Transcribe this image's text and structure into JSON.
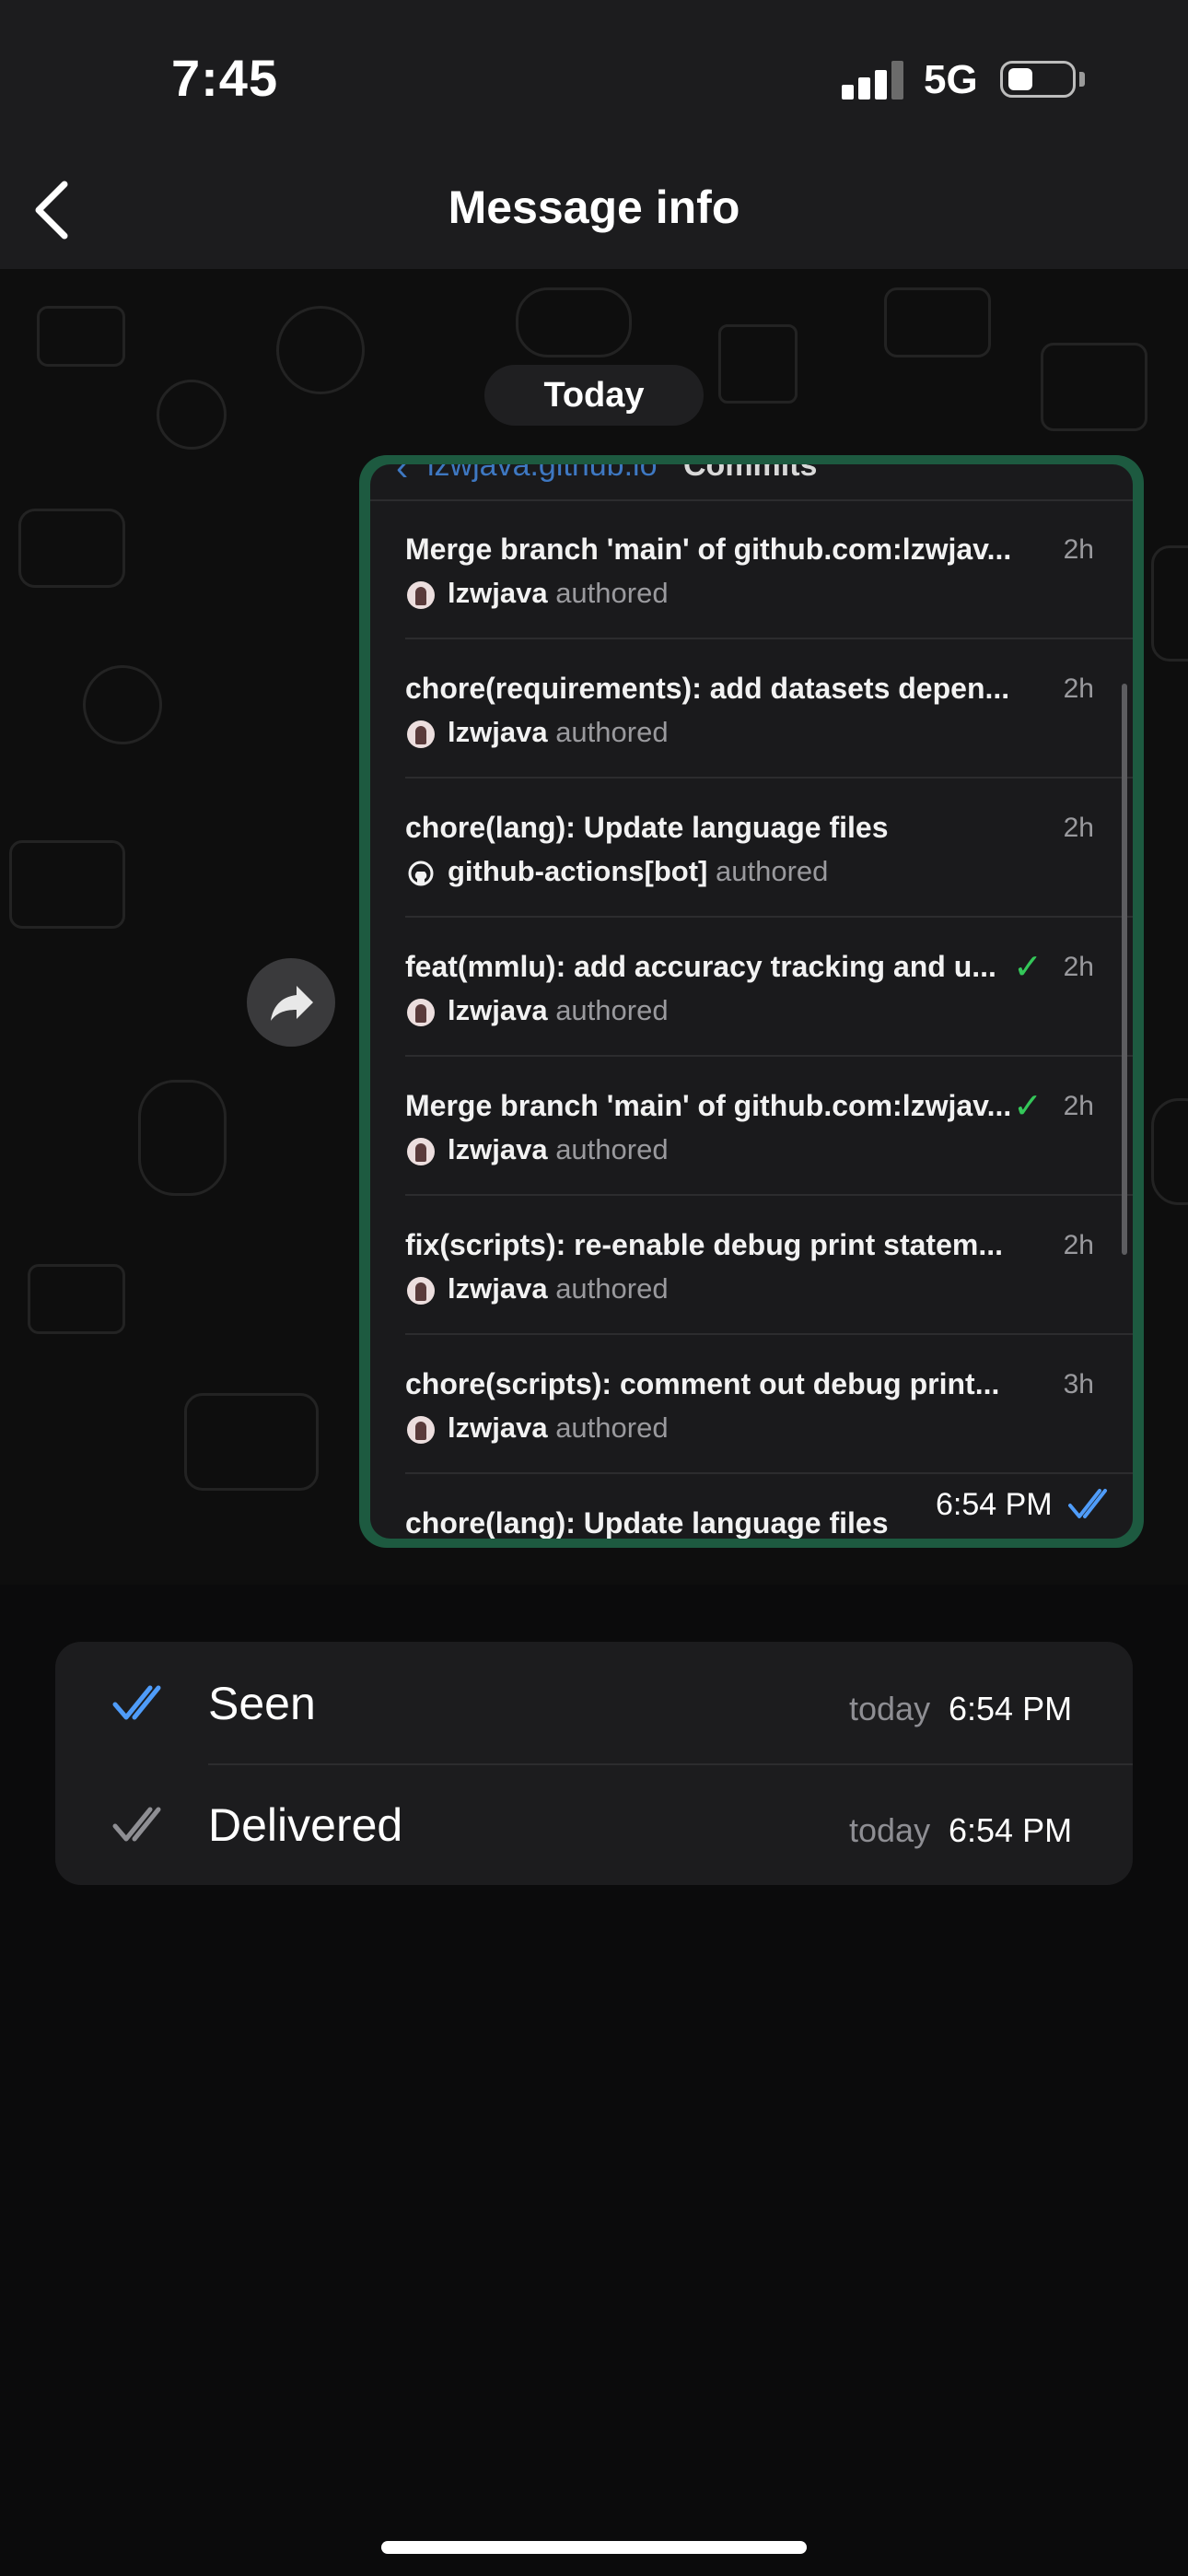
{
  "status_bar": {
    "time": "7:45",
    "network": "5G"
  },
  "nav": {
    "title": "Message info"
  },
  "chat": {
    "date_pill": "Today",
    "message_time": "6:54 PM",
    "screenshot": {
      "repo": "lzwjava.github.io",
      "section": "Commits",
      "commits": [
        {
          "title": "Merge branch 'main' of github.com:lzwjav...",
          "author": "lzwjava",
          "role": "authored",
          "age": "2h",
          "verified": false,
          "bot": false
        },
        {
          "title": "chore(requirements): add datasets depen...",
          "author": "lzwjava",
          "role": "authored",
          "age": "2h",
          "verified": false,
          "bot": false
        },
        {
          "title": "chore(lang): Update language files",
          "author": "github-actions[bot]",
          "role": "authored",
          "age": "2h",
          "verified": false,
          "bot": true
        },
        {
          "title": "feat(mmlu): add accuracy tracking and u...",
          "author": "lzwjava",
          "role": "authored",
          "age": "2h",
          "verified": true,
          "bot": false
        },
        {
          "title": "Merge branch 'main' of github.com:lzwjav...",
          "author": "lzwjava",
          "role": "authored",
          "age": "2h",
          "verified": true,
          "bot": false
        },
        {
          "title": "fix(scripts): re-enable debug print statem...",
          "author": "lzwjava",
          "role": "authored",
          "age": "2h",
          "verified": false,
          "bot": false
        },
        {
          "title": "chore(scripts): comment out debug print...",
          "author": "lzwjava",
          "role": "authored",
          "age": "3h",
          "verified": false,
          "bot": false
        },
        {
          "title": "chore(lang): Update language files",
          "author": "",
          "role": "",
          "age": "",
          "verified": false,
          "bot": false
        }
      ]
    }
  },
  "receipts": [
    {
      "label": "Seen",
      "day": "today",
      "time": "6:54 PM",
      "icon": "double-check-blue-icon",
      "color": "#4f9cf9"
    },
    {
      "label": "Delivered",
      "day": "today",
      "time": "6:54 PM",
      "icon": "double-check-gray-icon",
      "color": "#8e8e93"
    }
  ],
  "colors": {
    "bubble_border": "#1d5a40",
    "verified_check": "#34c759",
    "link_blue": "#3e78c2"
  }
}
